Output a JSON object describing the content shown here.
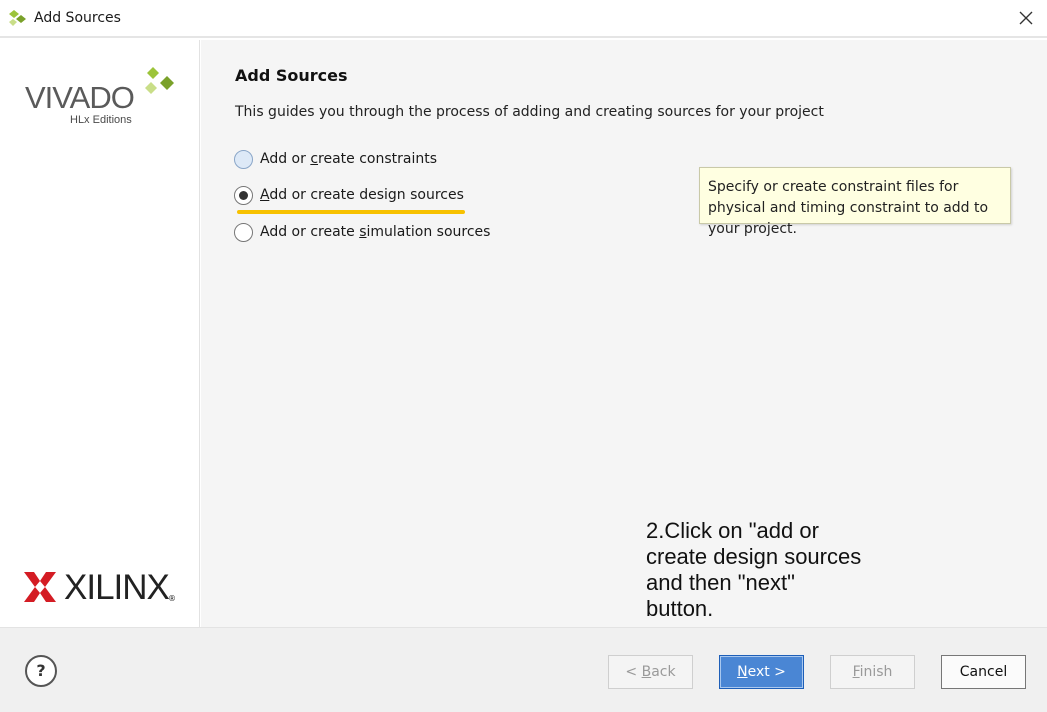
{
  "window": {
    "title": "Add Sources",
    "app_icon": "vivado-leaf-icon",
    "close_icon": "close-icon"
  },
  "sidebar": {
    "vivado_logo": {
      "word": "VIVADO",
      "sub": "HLx Editions",
      "reg": "®"
    },
    "xilinx_logo": {
      "word": "XILINX",
      "reg": "®"
    }
  },
  "main": {
    "heading": "Add Sources",
    "description": "This guides you through the process of adding and creating sources for your project",
    "options": [
      {
        "pre": "Add or ",
        "key": "c",
        "post": "reate constraints",
        "checked": false,
        "hover": true
      },
      {
        "pre": "",
        "key": "A",
        "post": "dd or create design sources",
        "checked": true,
        "hover": false
      },
      {
        "pre": "Add or create ",
        "key": "s",
        "post": "imulation sources",
        "checked": false,
        "hover": false
      }
    ],
    "tooltip": "Specify or create constraint files for physical and timing constraint to add to your project.",
    "annotation": "2.Click on \"add or create design sources and then \"next\" button.",
    "highlight_color": "#f7c100"
  },
  "footer": {
    "help_label": "?",
    "buttons": {
      "back": {
        "pre": "< ",
        "key": "B",
        "post": "ack",
        "enabled": false
      },
      "next": {
        "pre": "",
        "key": "N",
        "post": "ext >",
        "enabled": true
      },
      "finish": {
        "pre": "",
        "key": "F",
        "post": "inish",
        "enabled": false
      },
      "cancel": {
        "label": "Cancel",
        "enabled": true
      }
    }
  },
  "colors": {
    "accent": "#4a86d4",
    "tooltip_bg": "#ffffe1",
    "vivado_green": "#8dbb2f"
  }
}
